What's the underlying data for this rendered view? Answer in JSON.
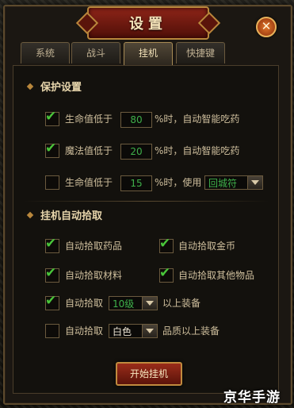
{
  "window": {
    "title": "设置",
    "close_glyph": "✕"
  },
  "tabs": [
    {
      "label": "系统",
      "active": false
    },
    {
      "label": "战斗",
      "active": false
    },
    {
      "label": "挂机",
      "active": true
    },
    {
      "label": "快捷键",
      "active": false
    }
  ],
  "protection": {
    "heading": "保护设置",
    "rows": [
      {
        "checked": true,
        "prefix": "生命值低于",
        "value": "80",
        "suffix": "%时，自动智能吃药"
      },
      {
        "checked": true,
        "prefix": "魔法值低于",
        "value": "20",
        "suffix": "%时，自动智能吃药"
      },
      {
        "checked": false,
        "prefix": "生命值低于",
        "value": "15",
        "suffix": "%时，使用",
        "item": "回城符"
      }
    ]
  },
  "autopick": {
    "heading": "挂机自动拾取",
    "items": [
      {
        "checked": true,
        "label": "自动拾取药品"
      },
      {
        "checked": true,
        "label": "自动拾取金币"
      },
      {
        "checked": true,
        "label": "自动拾取材料"
      },
      {
        "checked": true,
        "label": "自动拾取其他物品"
      }
    ],
    "equip_level": {
      "checked": true,
      "label": "自动拾取",
      "value": "10级",
      "suffix": "以上装备"
    },
    "equip_quality": {
      "checked": false,
      "label": "自动拾取",
      "value": "白色",
      "suffix": "品质以上装备"
    }
  },
  "start_button": "开始挂机",
  "watermark": "京华手游",
  "colors": {
    "accent_red": "#8d2418",
    "gold_border": "#b9873c",
    "value_green": "#3fb04a",
    "check_green": "#49c53a"
  }
}
